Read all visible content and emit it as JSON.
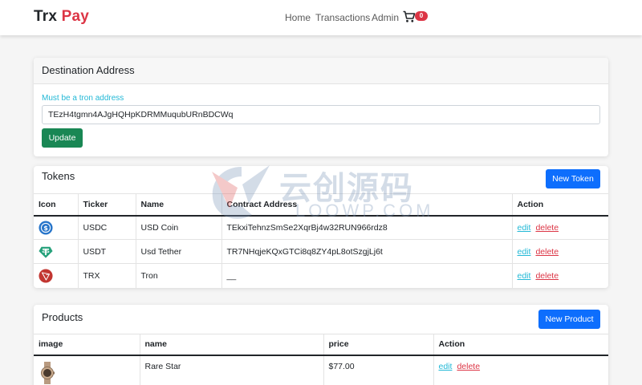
{
  "brand": {
    "part1": "Trx",
    "part2": "Pay"
  },
  "nav": {
    "home": "Home",
    "transactions": "Transactions",
    "admin": "Admin",
    "cart_count": "0"
  },
  "destination": {
    "title": "Destination Address",
    "helper": "Must be a tron address",
    "address_value": "TEzH4tgmn4AJgHQHpKDRMMuqubURnBDCWq",
    "update_label": "Update"
  },
  "tokens": {
    "title": "Tokens",
    "new_label": "New Token",
    "columns": [
      "Icon",
      "Ticker",
      "Name",
      "Contract Address",
      "Action"
    ],
    "rows": [
      {
        "icon": "usdc-icon",
        "ticker": "USDC",
        "name": "USD Coin",
        "contract": "TEkxiTehnzSmSe2XqrBj4w32RUN966rdz8",
        "edit": "edit",
        "delete": "delete"
      },
      {
        "icon": "usdt-icon",
        "ticker": "USDT",
        "name": "Usd Tether",
        "contract": "TR7NHqjeKQxGTCi8q8ZY4pL8otSzgjLj6t",
        "edit": "edit",
        "delete": "delete"
      },
      {
        "icon": "trx-icon",
        "ticker": "TRX",
        "name": "Tron",
        "contract": "__",
        "edit": "edit",
        "delete": "delete"
      }
    ]
  },
  "products": {
    "title": "Products",
    "new_label": "New Product",
    "columns": [
      "image",
      "name",
      "price",
      "Action"
    ],
    "rows": [
      {
        "image": "watch-image",
        "name": "Rare Star",
        "price": "$77.00",
        "edit": "edit",
        "delete": "delete"
      }
    ]
  },
  "watermark": {
    "text": "云创源码",
    "sub": "LOOWP.COM"
  },
  "colors": {
    "brand_red": "#dc3545",
    "primary": "#0d6efd",
    "success": "#198754",
    "info": "#22b8d6"
  }
}
